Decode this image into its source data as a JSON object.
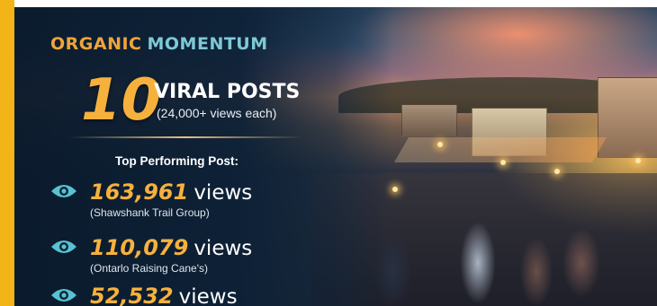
{
  "title": {
    "word1": "ORGANIC",
    "word2": "MOMENTUM"
  },
  "headline": {
    "number": "10",
    "label": "VIRAL POSTS",
    "sub": "(24,000+ views each)"
  },
  "top_label": "Top Performing Post:",
  "stats": [
    {
      "number": "163,961",
      "unit": "views",
      "source": "(Shawshank Trail Group)"
    },
    {
      "number": "110,079",
      "unit": "views",
      "source": "(Ontarlo Raising Cane's)"
    },
    {
      "number": "52,532",
      "unit": "views",
      "source": ""
    }
  ],
  "icons": {
    "views": "eye-icon"
  },
  "colors": {
    "accent_orange": "#f6b13d",
    "title_orange": "#f0a43a",
    "title_teal": "#7ec9d6",
    "icon_teal": "#58c2d0",
    "stripe_yellow": "#f2b417",
    "panel_navy": "#0c2036"
  }
}
